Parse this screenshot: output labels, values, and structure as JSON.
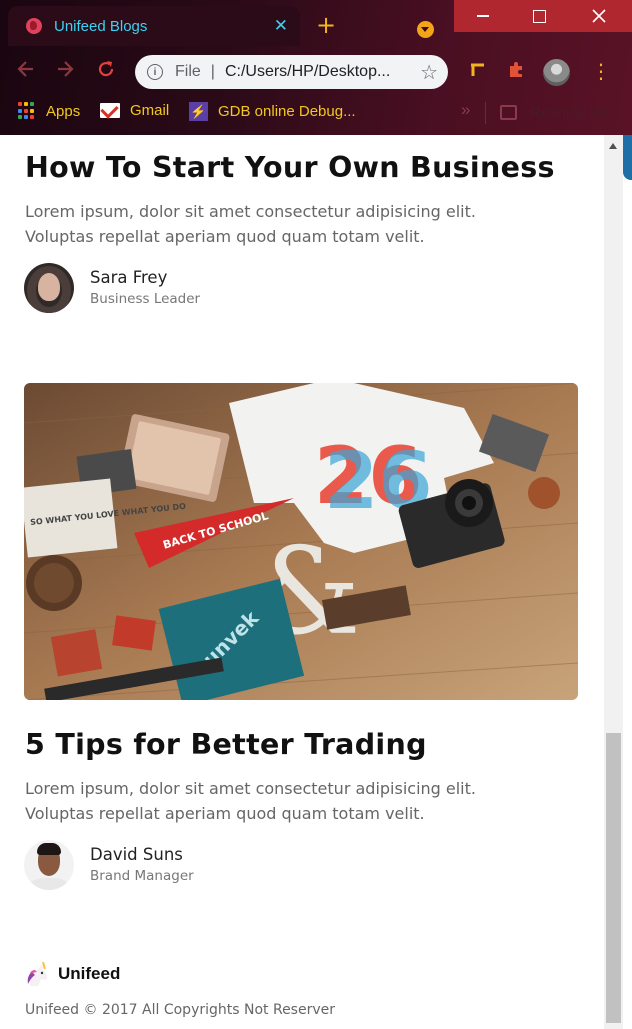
{
  "browser": {
    "tab_title": "Unifeed Blogs",
    "tab_close": "✕",
    "new_tab": "+",
    "file_label": "File",
    "url": "C:/Users/HP/Desktop...",
    "bookmarks": [
      {
        "label": "Apps",
        "icon": "apps-grid-icon"
      },
      {
        "label": "Gmail",
        "icon": "gmail-icon"
      },
      {
        "label": "GDB online Debug...",
        "icon": "gdb-icon"
      }
    ],
    "more_bookmarks": "»",
    "reading_list": "Reading list",
    "colors": {
      "accent": "#39d2f2",
      "bookmark_text": "#f2c81d",
      "titlebar": "#b1272f"
    }
  },
  "posts": [
    {
      "title": "How To Start Your Own Business",
      "excerpt_line1": "Lorem ipsum, dolor sit amet consectetur adipisicing elit.",
      "excerpt_line2": "Voluptas repellat aperiam quod quam totam velit.",
      "author_name": "Sara Frey",
      "author_role": "Business Leader"
    },
    {
      "title": "5 Tips for Better Trading",
      "excerpt_line1": "Lorem ipsum, dolor sit amet consectetur adipisicing elit.",
      "excerpt_line2": "Voluptas repellat aperiam quod quam totam velit.",
      "author_name": "David Suns",
      "author_role": "Brand Manager"
    }
  ],
  "hero_image": {
    "pennant_text": "BACK TO SCHOOL",
    "book_text": "unvek",
    "poster_text": "SO WHAT YOU LOVE WHAT YOU DO"
  },
  "footer": {
    "brand": "Unifeed",
    "copyright": "Unifeed © 2017 All Copyrights Not Reserver"
  }
}
